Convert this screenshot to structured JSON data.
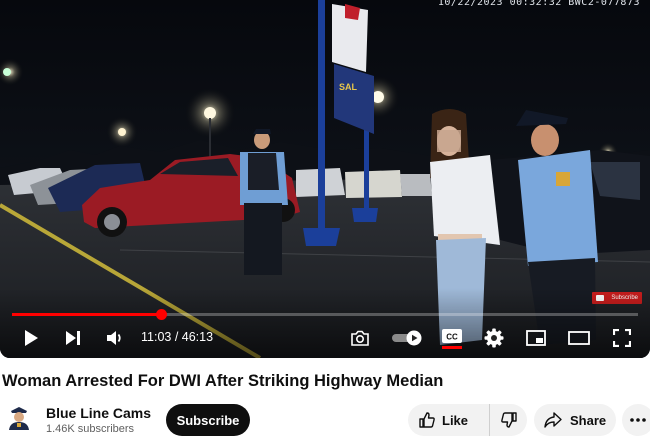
{
  "player": {
    "osd_text": "10/22/2023 00:32:32 BWC2-077873",
    "sign_letters": "SAL",
    "watermark_label": "Subscribe",
    "progress_fraction": 0.238,
    "time_display": "11:03 / 46:13",
    "icons": [
      "play-icon",
      "next-icon",
      "volume-icon",
      "camera-icon",
      "autoplay-toggle-icon",
      "cc-icon",
      "settings-icon",
      "miniplayer-icon",
      "theater-icon",
      "fullscreen-icon"
    ],
    "accent_color": "#ff0000"
  },
  "video": {
    "title": "Woman Arrested For DWI After Striking Highway Median"
  },
  "channel": {
    "name": "Blue Line Cams",
    "subscribers": "1.46K subscribers",
    "subscribe_label": "Subscribe"
  },
  "actions": {
    "like_label": "Like",
    "share_label": "Share"
  }
}
